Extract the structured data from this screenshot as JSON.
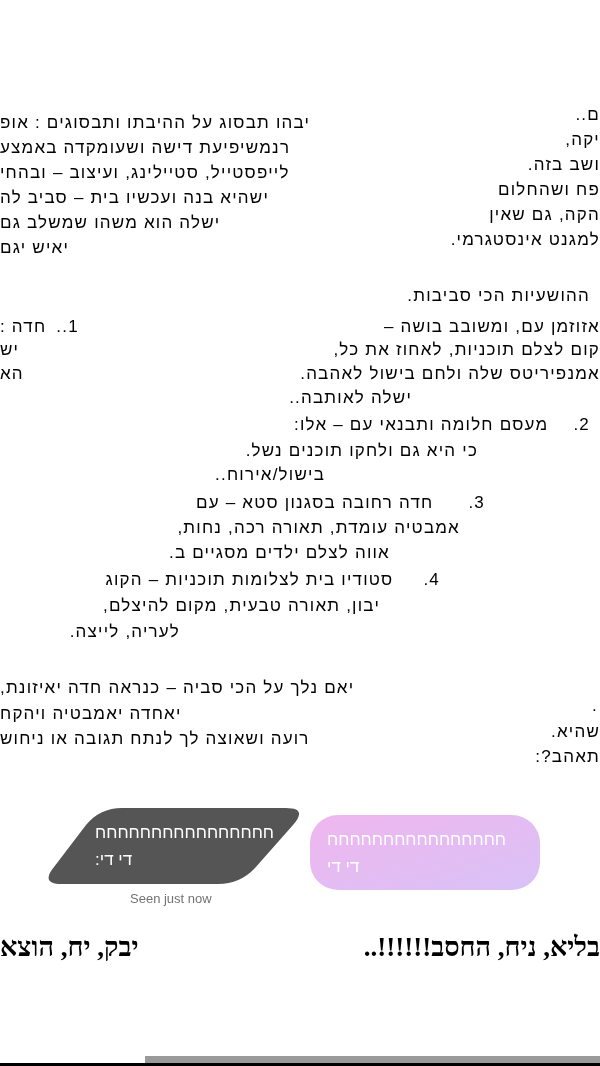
{
  "message_rows": [
    {
      "fragments": [
        "ם..",
        "יבהו תבסוג על ההיבתו ותבסוגים : אופ"
      ]
    },
    {
      "fragments": [
        "יקה,",
        "רנמשיפיעת דישה ושעומקדה באמצע"
      ]
    },
    {
      "fragments": [
        "ושב בזה.",
        "לייפסטייל, סטיילינג, ועיצוב – ובהחי"
      ]
    },
    {
      "fragments": [
        "פח ושהחלום",
        "ישהיא בנה ועכשיו בית – סביב לה"
      ]
    },
    {
      "fragments": [
        "הקה, גם שאין",
        "ישלה הוא משהו שמשלב גם"
      ]
    },
    {
      "fragments": [
        "למגנט אינסטגרמי.",
        "יאיש יגם"
      ]
    },
    {
      "fragments": [
        "ההושעיות הכי סביבות."
      ]
    },
    {
      "fragments": [
        "אזוזמן עם, ומשובב בושה –",
        "1..",
        "חדה :"
      ]
    },
    {
      "fragments": [
        "קום לצלם תוכניות, לאחוז את כל,",
        "יש"
      ]
    },
    {
      "fragments": [
        "אמנפיריטס שלה ולחם בישול לאהבה.",
        "הא"
      ]
    },
    {
      "fragments": [
        "ישלה לאותבה.."
      ]
    },
    {
      "fragments": [
        "2.",
        "מעסם חלומה ותבנאי עם – אלו:"
      ]
    },
    {
      "fragments": [
        "כי היא גם ולחקו תוכנים נשל."
      ]
    },
    {
      "fragments": [
        "בישול/אירוח.."
      ]
    },
    {
      "fragments": [
        "3.",
        "חדה רחובה בסגנון סטא – עם"
      ]
    },
    {
      "fragments": [
        "אמבטיה עומדת, תאורה רכה, נחות,"
      ]
    },
    {
      "fragments": [
        "אווה לצלם ילדים מסגיים ב."
      ]
    },
    {
      "fragments": [
        "4.",
        "סטודיו בית לצלומות תוכניות – הקוג"
      ]
    },
    {
      "fragments": [
        "יבון, תאורה טבעית, מקום להיצלם,"
      ]
    },
    {
      "fragments": [
        "לעריה, לייצה."
      ]
    },
    {
      "fragments": [
        ".",
        "יאם נלך על הכי סביה – כנראה חדה יאיזונת,"
      ]
    },
    {
      "fragments": [
        "שהיא.",
        "יאחדה יאמבטיה ויהקח"
      ]
    },
    {
      "fragments": [
        "תאהב?:",
        "רועה ושאוצה לך לנתח תגובה או ניחוש"
      ]
    }
  ],
  "chat": {
    "messages": [
      {
        "kind": "sent",
        "text": "חחחחחחחחחחחחחחחח\nדי די"
      },
      {
        "kind": "received",
        "text": "חחחחחחחחחחחחחחחח\nדי די:"
      }
    ],
    "seen_status": "Seen just now"
  },
  "large_line": {
    "fragments": [
      "בליא, ניח, החסב!!!!!!..",
      "יבק, יח, הוצא"
    ]
  }
}
